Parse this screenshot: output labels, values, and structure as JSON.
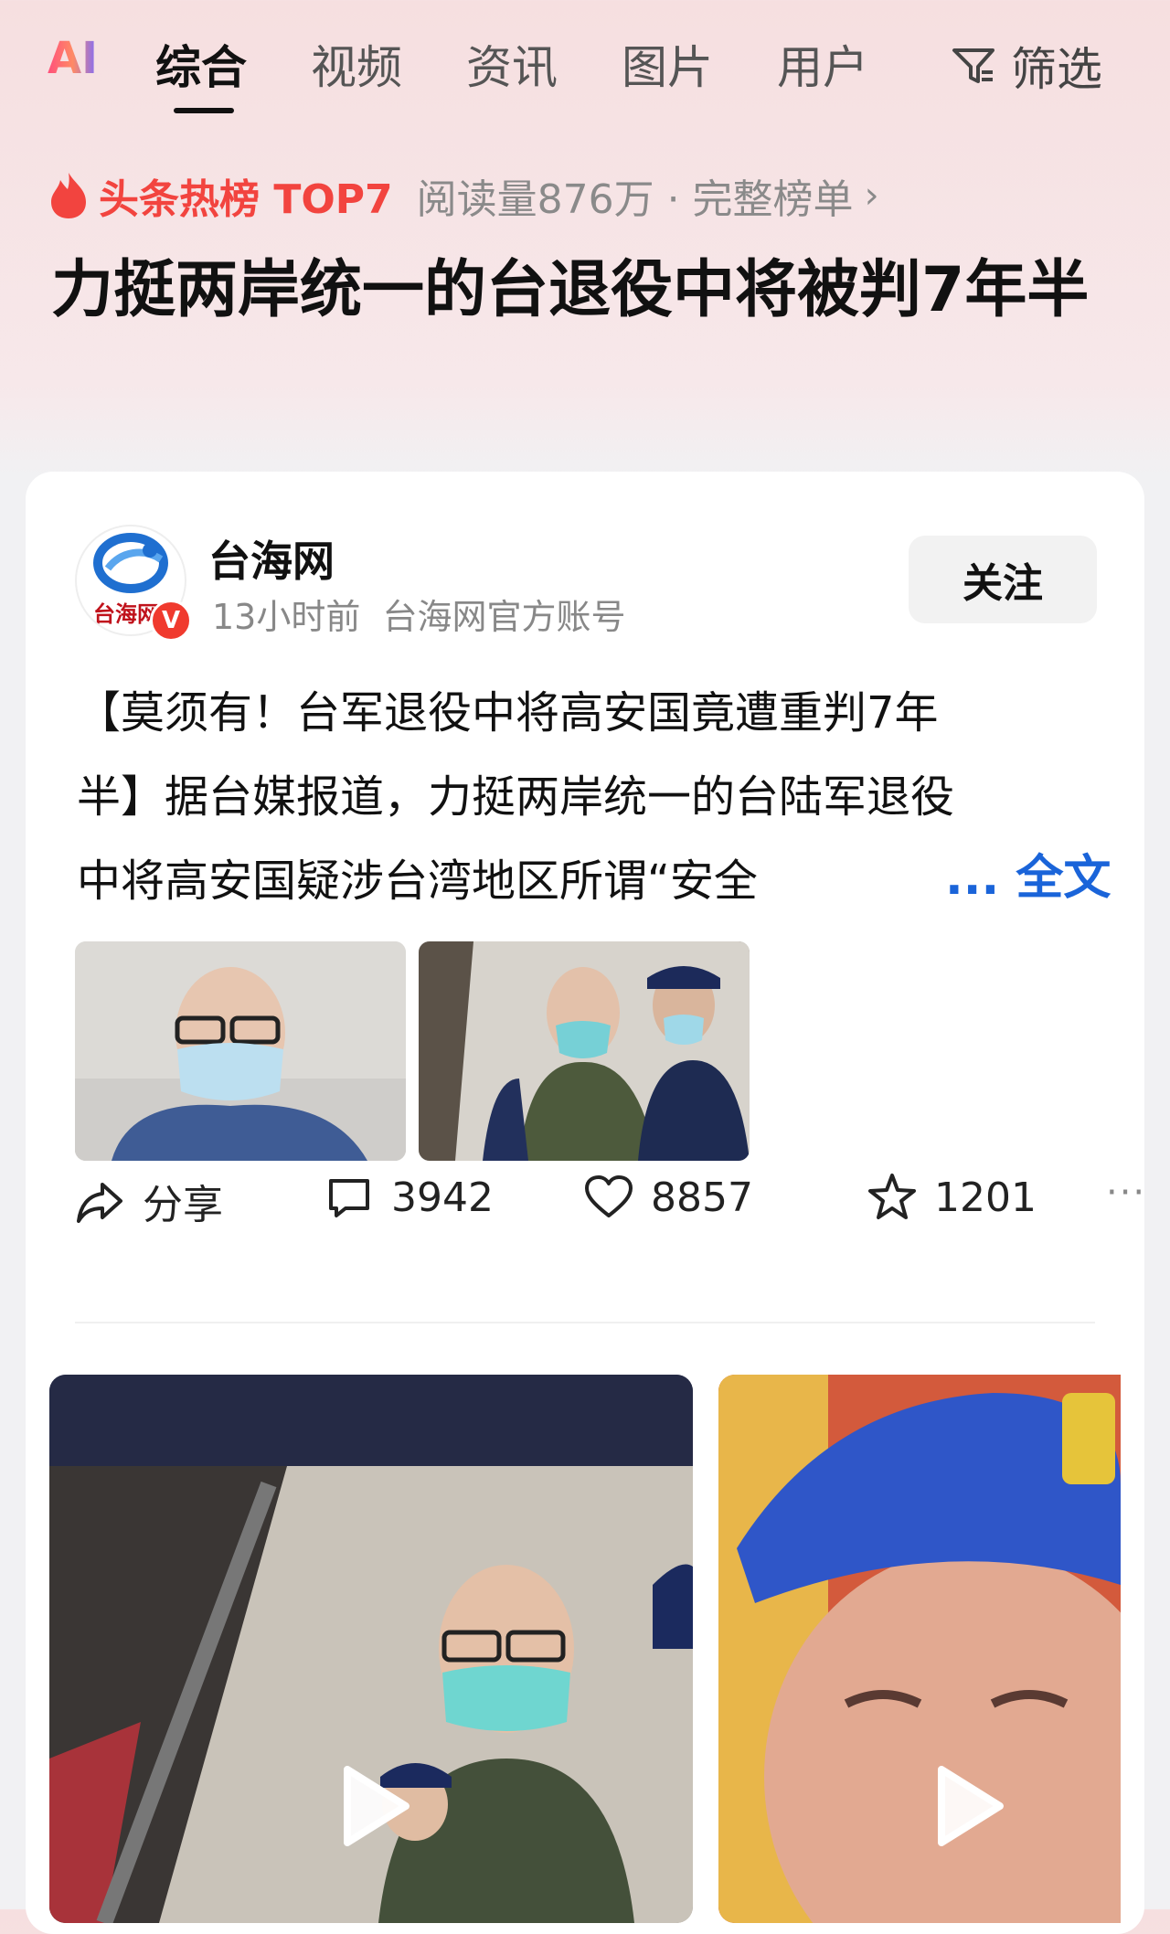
{
  "topnav": {
    "ai_label": "AI",
    "tabs": [
      "综合",
      "视频",
      "资讯",
      "图片",
      "用户"
    ],
    "active_tab": "综合",
    "filter_label": "筛选"
  },
  "hot": {
    "title": "头条热榜 TOP7",
    "meta": "阅读量876万 · 完整榜单"
  },
  "headline": "力挺两岸统一的台退役中将被判7年半",
  "card": {
    "source_name": "台海网",
    "avatar_text": "台海网",
    "verified_badge": "V",
    "time": "13小时前",
    "account_type": "台海网官方账号",
    "follow_label": "关注",
    "text_lines": [
      "【莫须有！台军退役中将高安国竟遭重判7年",
      "半】据台媒报道，力挺两岸统一的台陆军退役",
      "中将高安国疑涉台湾地区所谓“安全"
    ],
    "more_label": "... 全文",
    "actions": {
      "share": "分享",
      "comments": "3942",
      "likes": "8857",
      "favorites": "1201"
    }
  },
  "colors": {
    "hot_red": "#f2443f",
    "link_blue": "#1a64d9",
    "verified_red": "#f03a2e"
  },
  "icons": [
    "ai-logo",
    "filter-icon",
    "flame-icon",
    "share-icon",
    "comment-icon",
    "heart-icon",
    "star-icon",
    "more-dots-icon",
    "play-icon"
  ]
}
